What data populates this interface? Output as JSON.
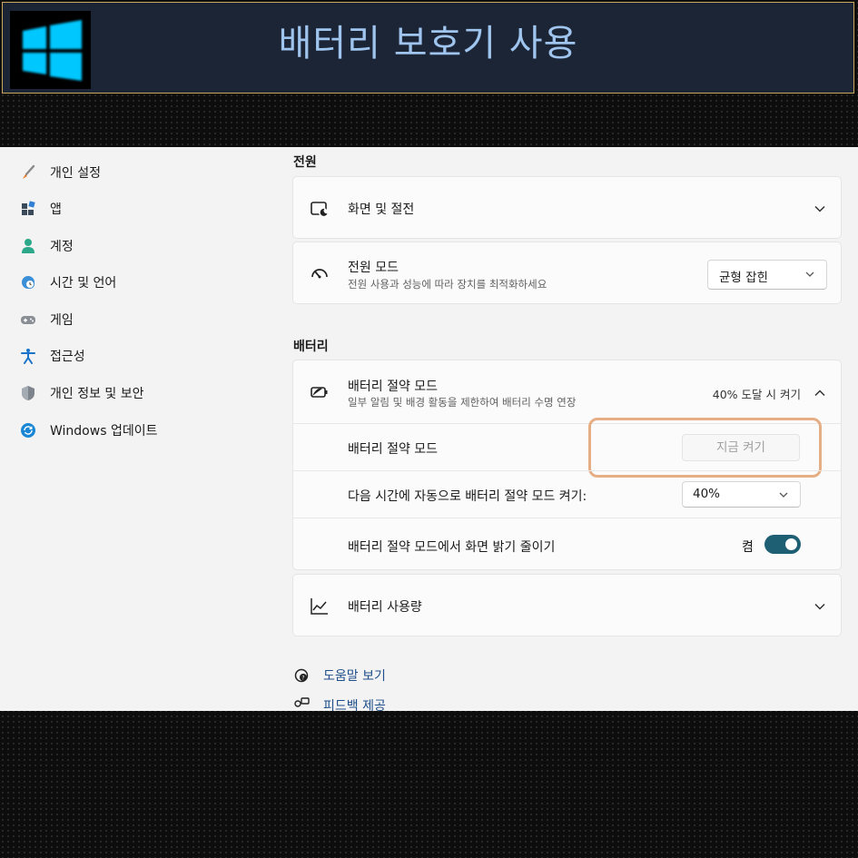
{
  "banner": {
    "title": "배터리 보호기 사용",
    "logo": "windows-logo-icon"
  },
  "sidebar": {
    "items": [
      {
        "label": "개인 설정",
        "icon": "brush-icon"
      },
      {
        "label": "앱",
        "icon": "apps-icon"
      },
      {
        "label": "계정",
        "icon": "account-icon"
      },
      {
        "label": "시간 및 언어",
        "icon": "globe-clock-icon"
      },
      {
        "label": "게임",
        "icon": "gamepad-icon"
      },
      {
        "label": "접근성",
        "icon": "accessibility-icon"
      },
      {
        "label": "개인 정보 및 보안",
        "icon": "shield-icon"
      },
      {
        "label": "Windows 업데이트",
        "icon": "update-icon"
      }
    ]
  },
  "power": {
    "section_title": "전원",
    "screen_sleep": {
      "title": "화면 및 절전",
      "icon": "screen-sleep-icon"
    },
    "power_mode": {
      "title": "전원 모드",
      "subtitle": "전원 사용과 성능에 따라 장치를 최적화하세요",
      "value": "균형 잡힌",
      "icon": "gauge-icon"
    }
  },
  "battery": {
    "section_title": "배터리",
    "saver": {
      "title": "배터리 절약 모드",
      "subtitle": "일부 알림 및 배경 활동을 제한하여 배터리 수명 연장",
      "status": "40% 도달 시 켜기",
      "icon": "battery-saver-icon"
    },
    "saver_now": {
      "label": "배터리 절약 모드",
      "button": "지금 켜기"
    },
    "auto_on": {
      "label": "다음 시간에 자동으로 배터리 절약 모드 켜기:",
      "value": "40%"
    },
    "brightness": {
      "label": "배터리 절약 모드에서 화면 밝기 줄이기",
      "state": "켬",
      "on": true
    },
    "usage": {
      "title": "배터리 사용량",
      "icon": "chart-icon"
    }
  },
  "links": [
    {
      "label": "도움말 보기",
      "icon": "help-icon"
    },
    {
      "label": "피드백 제공",
      "icon": "feedback-icon"
    }
  ],
  "colors": {
    "accent": "#1f5f73",
    "highlight": "#e0a070",
    "banner_text": "#9fc4ee",
    "logo": "#00c8ff"
  }
}
